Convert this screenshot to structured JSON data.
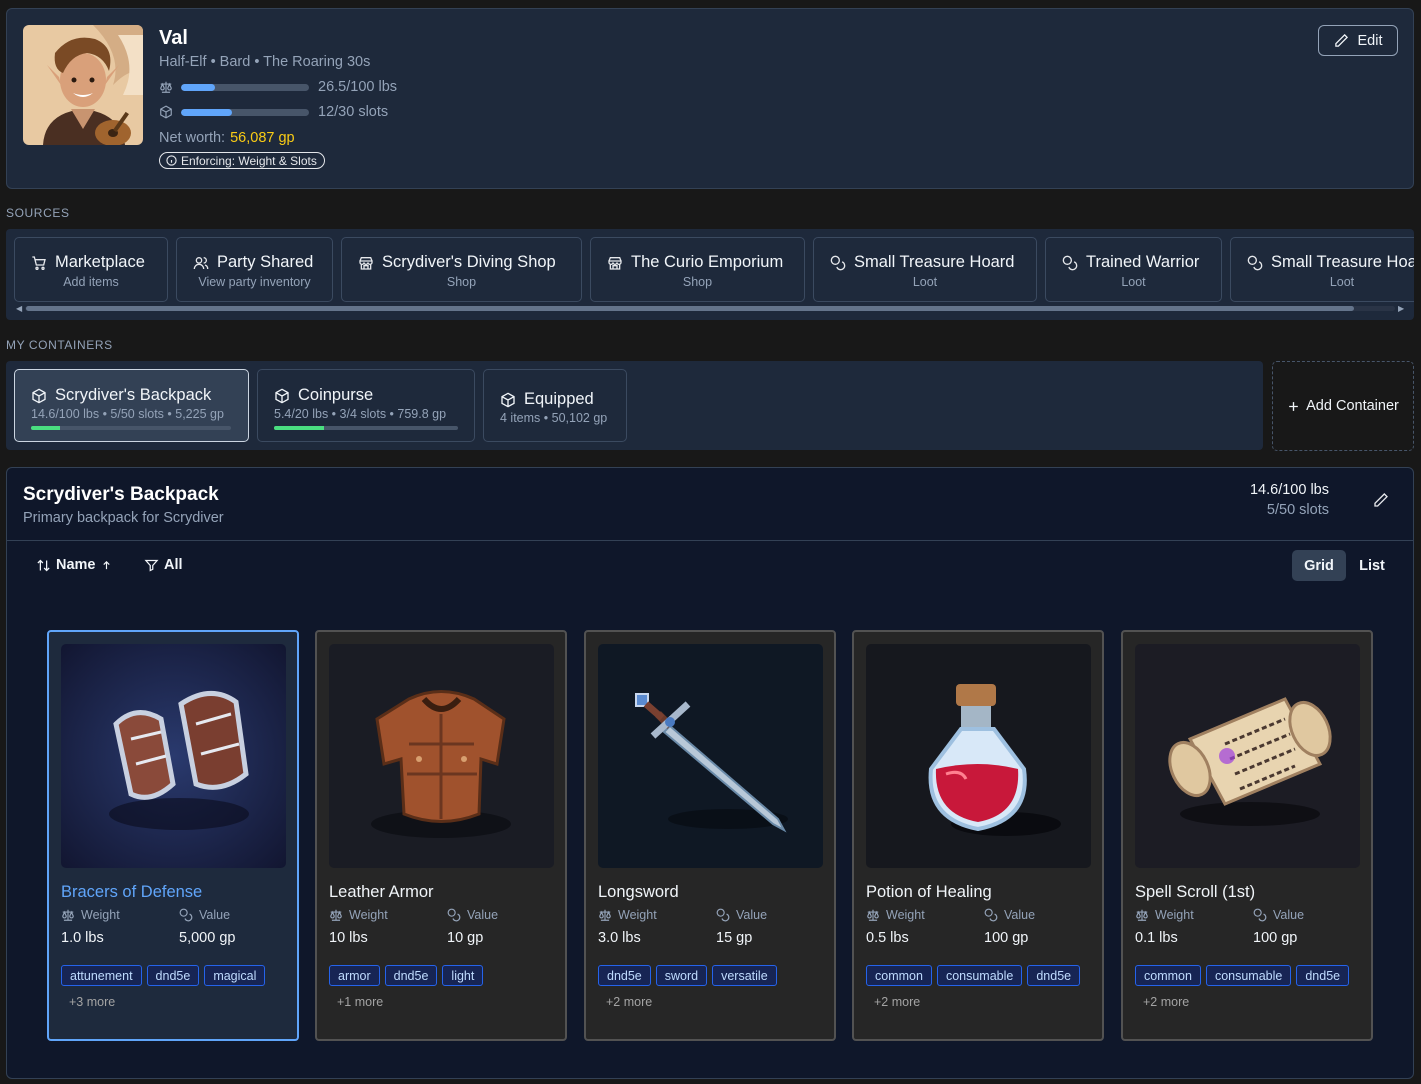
{
  "character": {
    "name": "Val",
    "subtitle": "Half-Elf • Bard • The Roaring 30s",
    "weight": {
      "text": "26.5/100 lbs",
      "fill": 0.265
    },
    "slots": {
      "text": "12/30 slots",
      "fill": 0.4
    },
    "net_worth_label": "Net worth:",
    "net_worth_value": "56,087 gp",
    "enforcing": "Enforcing: Weight & Slots",
    "edit_label": "Edit"
  },
  "sources": {
    "label": "SOURCES",
    "items": [
      {
        "name": "Marketplace",
        "sub": "Add items",
        "icon": "cart-icon"
      },
      {
        "name": "Party Shared",
        "sub": "View party inventory",
        "icon": "users-icon"
      },
      {
        "name": "Scrydiver's Diving Shop",
        "sub": "Shop",
        "icon": "store-icon"
      },
      {
        "name": "The Curio Emporium",
        "sub": "Shop",
        "icon": "store-icon"
      },
      {
        "name": "Small Treasure Hoard",
        "sub": "Loot",
        "icon": "coins-icon"
      },
      {
        "name": "Trained Warrior",
        "sub": "Loot",
        "icon": "coins-icon"
      },
      {
        "name": "Small Treasure Hoard",
        "sub": "Loot",
        "icon": "coins-icon"
      }
    ]
  },
  "containers": {
    "label": "MY CONTAINERS",
    "items": [
      {
        "name": "Scrydiver's Backpack",
        "meta": "14.6/100 lbs • 5/50 slots • 5,225 gp",
        "fill": 0.146
      },
      {
        "name": "Coinpurse",
        "meta": "5.4/20 lbs • 3/4 slots • 759.8 gp",
        "fill": 0.27
      },
      {
        "name": "Equipped",
        "meta": "4 items • 50,102 gp"
      }
    ],
    "add_label": "Add Container"
  },
  "backpack": {
    "title": "Scrydiver's Backpack",
    "description": "Primary backpack for Scrydiver",
    "weight": "14.6/100 lbs",
    "slots": "5/50 slots",
    "sort_label": "Name",
    "filter_label": "All",
    "view_grid": "Grid",
    "view_list": "List",
    "weight_label": "Weight",
    "value_label": "Value"
  },
  "items": [
    {
      "name": "Bracers of Defense",
      "weight": "1.0 lbs",
      "value": "5,000 gp",
      "tags": [
        "attunement",
        "dnd5e",
        "magical"
      ],
      "more": "+3 more"
    },
    {
      "name": "Leather Armor",
      "weight": "10 lbs",
      "value": "10 gp",
      "tags": [
        "armor",
        "dnd5e",
        "light"
      ],
      "more": "+1 more"
    },
    {
      "name": "Longsword",
      "weight": "3.0 lbs",
      "value": "15 gp",
      "tags": [
        "dnd5e",
        "sword",
        "versatile"
      ],
      "more": "+2 more"
    },
    {
      "name": "Potion of Healing",
      "weight": "0.5 lbs",
      "value": "100 gp",
      "tags": [
        "common",
        "consumable",
        "dnd5e"
      ],
      "more": "+2 more"
    },
    {
      "name": "Spell Scroll (1st)",
      "weight": "0.1 lbs",
      "value": "100 gp",
      "tags": [
        "common",
        "consumable",
        "dnd5e"
      ],
      "more": "+2 more"
    }
  ]
}
